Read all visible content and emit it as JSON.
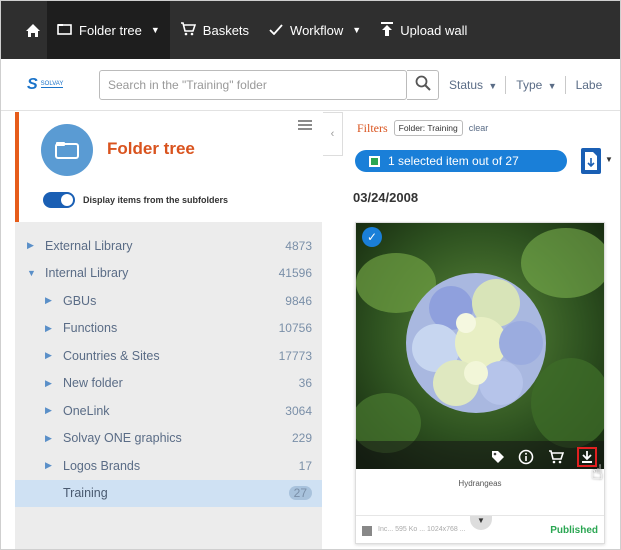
{
  "topnav": {
    "home_icon": "home-icon",
    "items": [
      {
        "label": "Folder tree",
        "icon": "folder-icon",
        "dropdown": true,
        "active": true
      },
      {
        "label": "Baskets",
        "icon": "cart-icon",
        "dropdown": false
      },
      {
        "label": "Workflow",
        "icon": "check-icon",
        "dropdown": true
      },
      {
        "label": "Upload wall",
        "icon": "upload-icon",
        "dropdown": false
      }
    ]
  },
  "toolbar": {
    "logo_text": "SOLVAY",
    "search_placeholder": "Search in the \"Training\" folder",
    "status_label": "Status",
    "type_label": "Type",
    "label_label": "Labe"
  },
  "sidebar": {
    "title": "Folder tree",
    "toggle_label": "Display items from the subfolders",
    "toggle_on": true,
    "tree": [
      {
        "label": "External Library",
        "count": "4873",
        "level": 0,
        "expanded": false
      },
      {
        "label": "Internal Library",
        "count": "41596",
        "level": 0,
        "expanded": true
      },
      {
        "label": "GBUs",
        "count": "9846",
        "level": 1
      },
      {
        "label": "Functions",
        "count": "10756",
        "level": 1
      },
      {
        "label": "Countries & Sites",
        "count": "17773",
        "level": 1
      },
      {
        "label": "New folder",
        "count": "36",
        "level": 1
      },
      {
        "label": "OneLink",
        "count": "3064",
        "level": 1
      },
      {
        "label": "Solvay ONE graphics",
        "count": "229",
        "level": 1
      },
      {
        "label": "Logos Brands",
        "count": "17",
        "level": 1
      },
      {
        "label": "Training",
        "count": "27",
        "level": 1,
        "selected": true
      }
    ]
  },
  "main": {
    "filters_label": "Filters",
    "filter_chip": "Folder: Training",
    "clear_label": "clear",
    "selection_text": "1 selected item out of 27",
    "date": "03/24/2008",
    "card": {
      "title": "Hydrangeas",
      "footer_text": "Inc... 595 Ko ... 1024x768 ...",
      "status": "Published",
      "status_color": "#2aa652"
    }
  },
  "colors": {
    "nav_bg": "#2f2f2f",
    "accent": "#1a7fd8",
    "title_orange": "#d9531e"
  }
}
